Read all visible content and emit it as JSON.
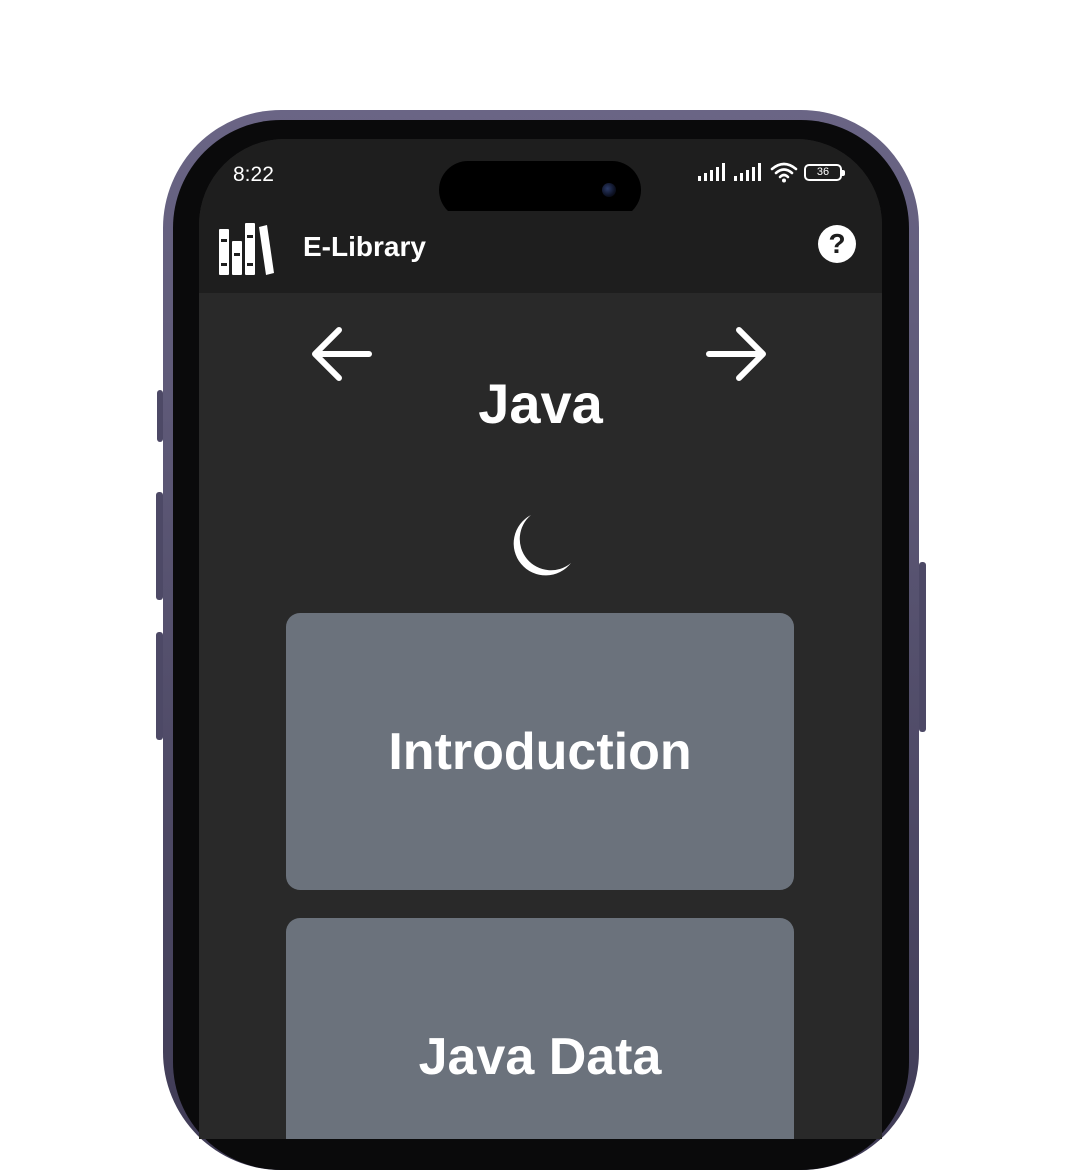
{
  "status_bar": {
    "time": "8:22",
    "battery": "36",
    "icons": [
      "cellular-signal-icon",
      "cellular-signal-icon",
      "wifi-icon",
      "battery-icon"
    ]
  },
  "app_bar": {
    "logo_icon": "library-books-icon",
    "title": "E-Library",
    "help_label": "?",
    "help_icon": "help-circle-icon"
  },
  "page": {
    "back_icon": "arrow-left-icon",
    "forward_icon": "arrow-right-icon",
    "title": "Java",
    "theme_icon": "moon-icon"
  },
  "topics": [
    {
      "label": "Introduction"
    },
    {
      "label": "Java Data"
    }
  ],
  "colors": {
    "screen_bg": "#292929",
    "app_bar_bg": "#1e1e1e",
    "card_bg": "#6b727c",
    "text": "#ffffff",
    "phone_frame": "#4d4966"
  }
}
